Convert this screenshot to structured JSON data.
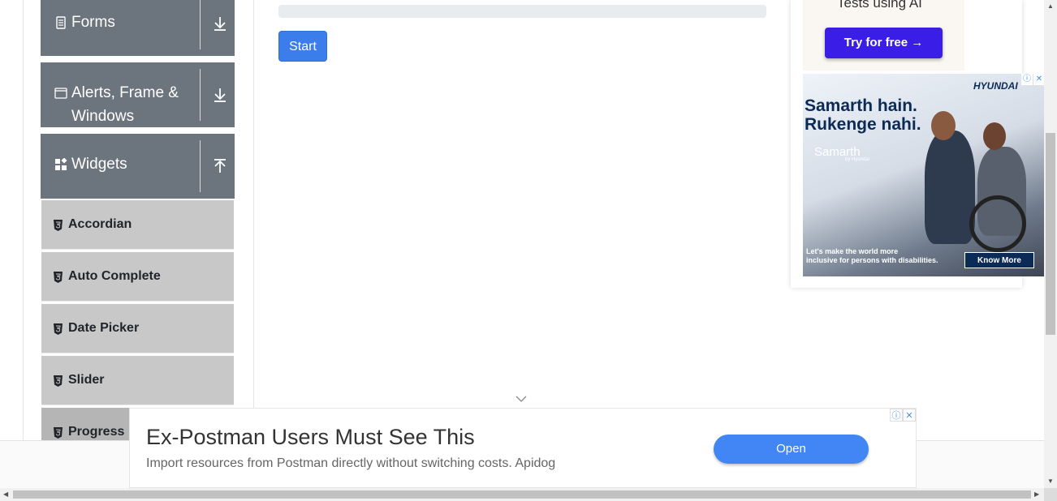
{
  "sidebar": {
    "groups": [
      {
        "label": "Forms",
        "icon": "document-icon",
        "arrow": "download-icon"
      },
      {
        "label_line1": "Alerts, Frame &",
        "label_line2": "Windows",
        "icon": "window-icon",
        "arrow": "download-icon"
      },
      {
        "label": "Widgets",
        "icon": "widgets-icon",
        "arrow": "upload-icon"
      }
    ],
    "items": [
      {
        "label": "Accordian"
      },
      {
        "label": "Auto Complete"
      },
      {
        "label": "Date Picker"
      },
      {
        "label": "Slider"
      },
      {
        "label": "Progress"
      }
    ]
  },
  "main": {
    "progress_value": 0,
    "start_label": "Start"
  },
  "ads": {
    "side_top_text": "Tests using AI",
    "side_top_button": "Try for free →",
    "side_brand": "HYUNDAI",
    "side_headline_1": "Samarth hain.",
    "side_headline_2": "Rukenge nahi.",
    "side_logo_text": "Samarth",
    "side_logo_sub": "by Hyundai",
    "side_foot_1": "Let's make the world more",
    "side_foot_2": "inclusive for persons with disabilities.",
    "side_button": "Know More",
    "bottom_title": "Ex-Postman Users Must See This",
    "bottom_sub": "Import resources from Postman directly without switching costs. Apidog",
    "bottom_button": "Open"
  },
  "colors": {
    "sidebar_group_bg": "#6c757d",
    "sidebar_item_bg": "#c8c8c8",
    "start_button": "#3b7dea",
    "try_button": "#3a1ee8",
    "open_button": "#4285f4"
  }
}
